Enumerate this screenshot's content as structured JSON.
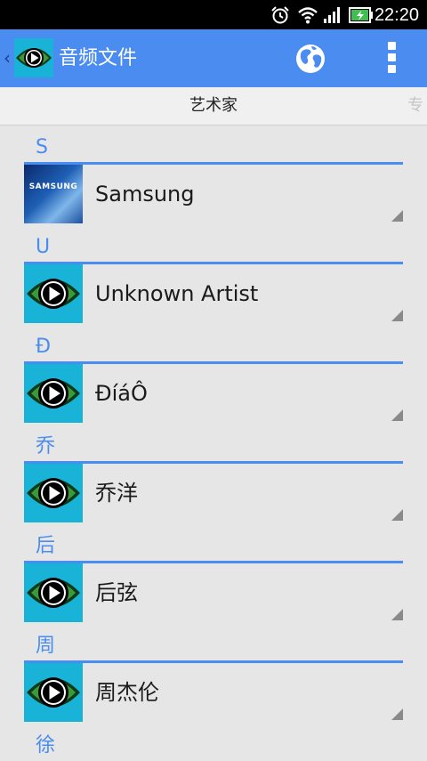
{
  "status_bar": {
    "time": "22:20",
    "icons": [
      "alarm-icon",
      "wifi-icon",
      "signal-icon",
      "battery-charging-icon"
    ]
  },
  "action_bar": {
    "title": "音频文件",
    "up_glyph": "‹",
    "app_icon": "eye-play-icon",
    "actions": [
      "globe-icon",
      "overflow-menu-icon"
    ]
  },
  "tabs": {
    "active": "艺术家",
    "next_partial": "专"
  },
  "sections": [
    {
      "letter": "S",
      "artist": "Samsung",
      "thumb": "samsung-logo"
    },
    {
      "letter": "U",
      "artist": "Unknown Artist",
      "thumb": "eye-play-icon"
    },
    {
      "letter": "Ð",
      "artist": "ÐíáÔ",
      "thumb": "eye-play-icon"
    },
    {
      "letter": "乔",
      "artist": "乔洋",
      "thumb": "eye-play-icon"
    },
    {
      "letter": "后",
      "artist": "后弦",
      "thumb": "eye-play-icon"
    },
    {
      "letter": "周",
      "artist": "周杰伦",
      "thumb": "eye-play-icon"
    },
    {
      "letter": "徐",
      "artist": "",
      "thumb": ""
    }
  ],
  "samsung_thumb_text": "SAMSUNG",
  "colors": {
    "accent": "#4a8cf0",
    "background": "#e6e6e6",
    "status_bar": "#000000"
  }
}
